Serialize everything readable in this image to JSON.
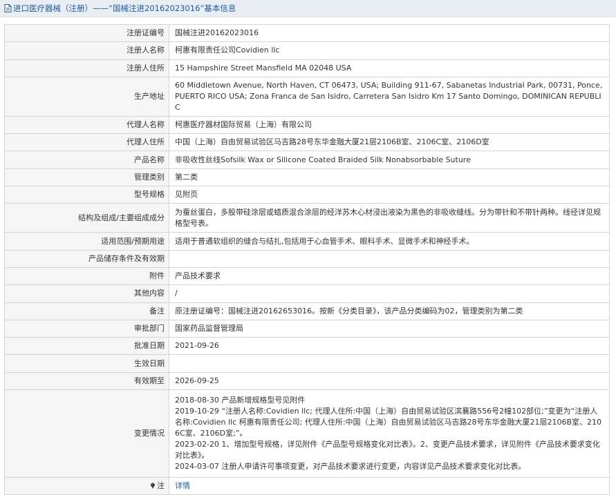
{
  "header": {
    "title": "进口医疗器械（注册）——“国械注进20162023016”基本信息"
  },
  "fields": {
    "reg_no": {
      "label": "注册证编号",
      "value": "国械注进20162023016"
    },
    "registrant_name": {
      "label": "注册人名称",
      "value": "柯惠有限责任公司Covidien llc"
    },
    "registrant_address": {
      "label": "注册人住所",
      "value": "15 Hampshire Street Mansfield MA 02048 USA"
    },
    "production_address": {
      "label": "生产地址",
      "value": "60 Middletown Avenue, North Haven, CT 06473, USA; Building 911-67, Sabanetas Industrial Park, 00731, Ponce, PUERTO RICO USA; Zona Franca de San Isidro, Carretera San Isidro Km 17 Santo Domingo, DOMINICAN REPUBLIC"
    },
    "agent_name": {
      "label": "代理人名称",
      "value": "柯惠医疗器材国际贸易（上海）有限公司"
    },
    "agent_address": {
      "label": "代理人住所",
      "value": "中国（上海）自由贸易试验区马吉路28号东华金融大厦21层2106B室、2106C室、2106D室"
    },
    "product_name": {
      "label": "产品名称",
      "value": "非吸收性丝线Sofsilk Wax or Silicone Coated Braided Silk Nonabsorbable Suture"
    },
    "category": {
      "label": "管理类别",
      "value": "第二类"
    },
    "model": {
      "label": "型号规格",
      "value": "见附页"
    },
    "structure": {
      "label": "结构及组成/主要组成成分",
      "value": "为蚕丝蛋白，多股带硅涂层或蜡质混合涂层的经洋苏木心材浸出液染为黑色的非吸收缝线。分为带针和不带针两种。线径详见规格型号表。"
    },
    "scope": {
      "label": "适用范围/预期用途",
      "value": "适用于普通软组织的缝合与结扎,包括用于心血管手术、眼科手术、显微手术和神经手术。"
    },
    "storage": {
      "label": "产品储存条件及有效期",
      "value": ""
    },
    "attachment": {
      "label": "附件",
      "value": "产品技术要求"
    },
    "other": {
      "label": "其他内容",
      "value": "/"
    },
    "remarks": {
      "label": "备注",
      "value": "原注册证编号：国械注进20162653016。按新《分类目录》，该产品分类编码为02，管理类别为第二类"
    },
    "approval_dept": {
      "label": "审批部门",
      "value": "国家药品监督管理局"
    },
    "approval_date": {
      "label": "批准日期",
      "value": "2021-09-26"
    },
    "effective_date": {
      "label": "生效日期",
      "value": ""
    },
    "valid_until": {
      "label": "有效期至",
      "value": "2026-09-25"
    },
    "changes": {
      "label": "变更情况",
      "lines": [
        "2018-08-30 产品新增规格型号见附件",
        "2019-10-29 “注册人名称:Covidien llc; 代理人住所:中国（上海）自由贸易试验区滨襄路556号2幢102部位;”变更为“注册人名称:Covidien llc 柯惠有限责任公司; 代理人住所:中国（上海）自由贸易试验区马吉路28号东华金融大厦21层2106B室、2106C室、2106D室;”。",
        "2023-02-20 1、增加型号规格，详见附件《产品型号规格变化对比表》。2、变更产品技术要求，详见附件《产品技术要求变化对比表》。",
        "2024-03-07 注册人申请许可事项变更，对产品技术要求进行变更，内容详见产品技术要求变化对比表。"
      ]
    },
    "note": {
      "label": "注",
      "link": "详情"
    }
  }
}
